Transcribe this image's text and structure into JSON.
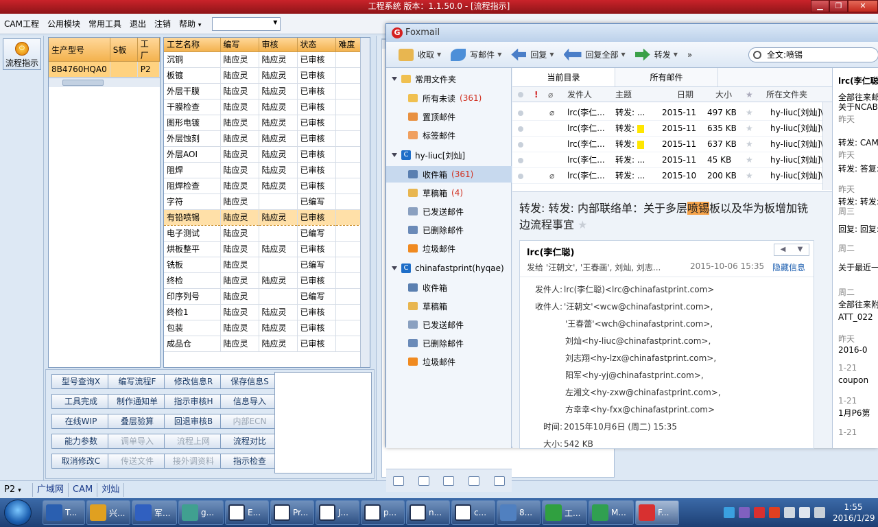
{
  "window": {
    "title": "工程系统  版本：1.1.50.0 - [流程指示]",
    "min": "▁",
    "max": "❐",
    "close": "✕"
  },
  "menu": [
    "CAM工程",
    "公用模块",
    "常用工具",
    "退出",
    "注销",
    "帮助"
  ],
  "menu_help_arrow": "▾",
  "leftbar": {
    "flow_label": "流程指示"
  },
  "product": {
    "headers": [
      "生产型号",
      "S板",
      "工厂"
    ],
    "row": [
      "8B4760HQA0",
      "",
      "P2"
    ]
  },
  "process": {
    "headers": [
      "工艺名称",
      "编写",
      "审核",
      "状态",
      "难度"
    ],
    "rows": [
      [
        "沉铜",
        "陆应灵",
        "陆应灵",
        "已审核",
        ""
      ],
      [
        "板镀",
        "陆应灵",
        "陆应灵",
        "已审核",
        ""
      ],
      [
        "外层干膜",
        "陆应灵",
        "陆应灵",
        "已审核",
        ""
      ],
      [
        "干膜检查",
        "陆应灵",
        "陆应灵",
        "已审核",
        ""
      ],
      [
        "图形电镀",
        "陆应灵",
        "陆应灵",
        "已审核",
        ""
      ],
      [
        "外层蚀刻",
        "陆应灵",
        "陆应灵",
        "已审核",
        ""
      ],
      [
        "外层AOI",
        "陆应灵",
        "陆应灵",
        "已审核",
        ""
      ],
      [
        "阻焊",
        "陆应灵",
        "陆应灵",
        "已审核",
        ""
      ],
      [
        "阻焊检查",
        "陆应灵",
        "陆应灵",
        "已审核",
        ""
      ],
      [
        "字符",
        "陆应灵",
        "",
        "已编写",
        ""
      ],
      [
        "有铅喷锡",
        "陆应灵",
        "陆应灵",
        "已审核",
        ""
      ],
      [
        "电子测试",
        "陆应灵",
        "",
        "已编写",
        ""
      ],
      [
        "烘板整平",
        "陆应灵",
        "陆应灵",
        "已审核",
        ""
      ],
      [
        "铣板",
        "陆应灵",
        "",
        "已编写",
        ""
      ],
      [
        "终检",
        "陆应灵",
        "陆应灵",
        "已审核",
        ""
      ],
      [
        "印序列号",
        "陆应灵",
        "",
        "已编写",
        ""
      ],
      [
        "终检1",
        "陆应灵",
        "陆应灵",
        "已审核",
        ""
      ],
      [
        "包装",
        "陆应灵",
        "陆应灵",
        "已审核",
        ""
      ],
      [
        "成品仓",
        "陆应灵",
        "陆应灵",
        "已审核",
        ""
      ]
    ]
  },
  "buttons": [
    [
      "型号查询X",
      "编写流程F",
      "修改信息R",
      "保存信息S"
    ],
    [
      "工具完成",
      "制作通知单",
      "指示审核H",
      "信息导入"
    ],
    [
      "在线WIP",
      "叠层验算",
      "回退审核B",
      "内部ECN"
    ],
    [
      "能力参数",
      "调单导入",
      "流程上网",
      "流程对比"
    ],
    [
      "取消修改C",
      "传送文件",
      "接外调资料",
      "指示检查"
    ]
  ],
  "disabled_buttons": [
    "内部ECN",
    "调单导入",
    "流程上网",
    "传送文件",
    "接外调资料"
  ],
  "status": [
    "P2",
    "广域网",
    "CAM",
    "刘灿"
  ],
  "status_arrow": "▾",
  "foxmail": {
    "title": "Foxmail",
    "logo": "G",
    "toolbar": [
      "收取",
      "写邮件",
      "回复",
      "回复全部",
      "转发"
    ],
    "more": "»",
    "search": "全文:喷锡",
    "folders_common": {
      "title": "常用文件夹",
      "items": [
        {
          "label": "所有未读",
          "count": "(361)"
        },
        {
          "label": "置顶邮件",
          "count": ""
        },
        {
          "label": "标签邮件",
          "count": ""
        }
      ]
    },
    "account1": {
      "name": "hy-liuc[刘灿]",
      "items": [
        {
          "label": "收件箱",
          "count": "(361)"
        },
        {
          "label": "草稿箱",
          "count": "(4)"
        },
        {
          "label": "已发送邮件",
          "count": ""
        },
        {
          "label": "已删除邮件",
          "count": ""
        },
        {
          "label": "垃圾邮件",
          "count": ""
        }
      ]
    },
    "account2": {
      "name": "chinafastprint(hyqae)",
      "items": [
        {
          "label": "收件箱",
          "count": ""
        },
        {
          "label": "草稿箱",
          "count": ""
        },
        {
          "label": "已发送邮件",
          "count": ""
        },
        {
          "label": "已删除邮件",
          "count": ""
        },
        {
          "label": "垃圾邮件",
          "count": ""
        }
      ]
    },
    "tabs": [
      "当前目录",
      "所有邮件"
    ],
    "list_headers": {
      "sender": "发件人",
      "subject": "主题",
      "date": "日期",
      "size": "大小",
      "folder": "所在文件夹",
      "flag": "!",
      "attach": "⌀"
    },
    "mails": [
      {
        "sender": "lrc(李仁...",
        "subject": "转发: ...",
        "date": "2015-11",
        "size": "497 KB",
        "folder": "hy-liuc[刘灿]\\",
        "attach": true,
        "hl": false
      },
      {
        "sender": "lrc(李仁...",
        "subject": "转发:",
        "date": "2015-11",
        "size": "635 KB",
        "folder": "hy-liuc[刘灿]\\",
        "attach": false,
        "hl": true
      },
      {
        "sender": "lrc(李仁...",
        "subject": "转发:",
        "date": "2015-11",
        "size": "637 KB",
        "folder": "hy-liuc[刘灿]\\",
        "attach": false,
        "hl": true
      },
      {
        "sender": "lrc(李仁...",
        "subject": "转发: ...",
        "date": "2015-11",
        "size": "45 KB",
        "folder": "hy-liuc[刘灿]\\",
        "attach": false,
        "hl": false
      },
      {
        "sender": "lrc(李仁...",
        "subject": "转发: ...",
        "date": "2015-10",
        "size": "200 KB",
        "folder": "hy-liuc[刘灿]\\",
        "attach": true,
        "hl": false
      }
    ],
    "preview": {
      "subject_pre": "转发: 转发: 内部联络单：关于多层",
      "subject_hl": "喷锡",
      "subject_post": "板以及华为板增加铣边流程事宜",
      "sender": "lrc(李仁聪)",
      "sendto": "发给 '汪朝文', '王春画', 刘灿, 刘志...",
      "date": "2015-10-06 15:35",
      "hide": "隐藏信息",
      "from_key": "发件人:",
      "from": "lrc(李仁聪)<lrc@chinafastprint.com>",
      "to_key": "收件人:",
      "to": [
        "'汪朝文'<wcw@chinafastprint.com>,",
        "'王春蕾'<wch@chinafastprint.com>,",
        "刘灿<hy-liuc@chinafastprint.com>,",
        "刘志翔<hy-lzx@chinafastprint.com>,",
        "阳军<hy-yj@chinafastprint.com>,",
        "左湘文<hy-zxw@chinafastprint.com>,",
        "方幸幸<hy-fxx@chinafastprint.com>"
      ],
      "time_key": "时间:",
      "time": "2015年10月6日 (周二) 15:35",
      "size_key": "大小:",
      "size": "542 KB"
    },
    "right_list": [
      {
        "t": "lrc(李仁聪)",
        "s": ""
      },
      {
        "t": "全部往来邮",
        "s": ""
      },
      {
        "t": "关于NCAB",
        "s": "昨天"
      },
      {
        "t": "转发: CAM",
        "s": "昨天"
      },
      {
        "t": "转发: 答复:",
        "s": "昨天"
      },
      {
        "t": "转发: 转发:",
        "s": "周三"
      },
      {
        "t": "回复: 回复:",
        "s": "周二"
      },
      {
        "t": "关于最近一",
        "s": "周二"
      },
      {
        "t": "全部往来附",
        "s": ""
      },
      {
        "t": "ATT_022",
        "s": "昨天"
      },
      {
        "t": "2016-0",
        "s": "1-21"
      },
      {
        "t": "coupon",
        "s": "1-21"
      },
      {
        "t": "1月P6第",
        "s": "1-21"
      }
    ]
  },
  "taskbar": {
    "items": [
      "T...",
      "兴...",
      "军...",
      "g...",
      "E...",
      "Pr...",
      "J...",
      "p...",
      "n...",
      "c...",
      "8...",
      "工...",
      "M...",
      "F..."
    ],
    "time": "1:55",
    "date": "2016/1/29"
  }
}
